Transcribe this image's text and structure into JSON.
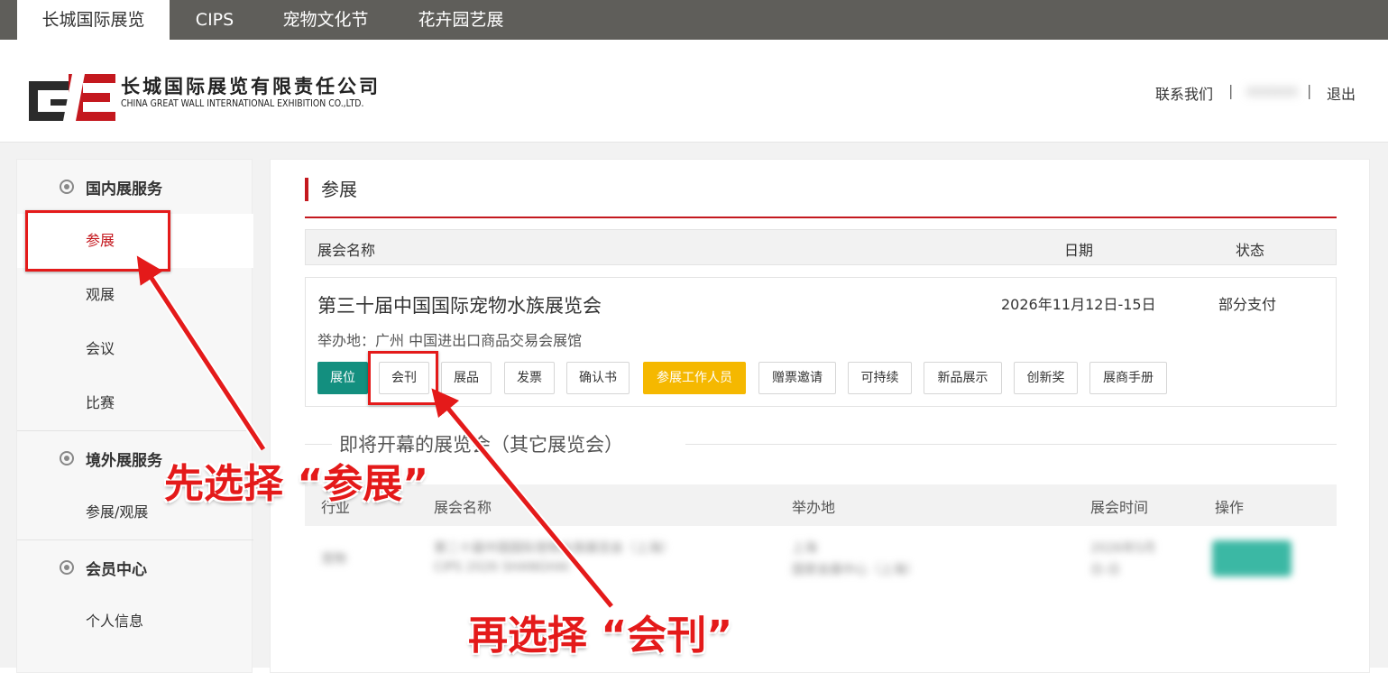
{
  "topnav": {
    "tabs": [
      {
        "label": "长城国际展览",
        "active": true
      },
      {
        "label": "CIPS",
        "active": false
      },
      {
        "label": "宠物文化节",
        "active": false
      },
      {
        "label": "花卉园艺展",
        "active": false
      }
    ]
  },
  "header": {
    "logo_letters": "GE",
    "logo_cn": "长城国际展览有限责任公司",
    "logo_en": "CHINA GREAT WALL INTERNATIONAL EXHIBITION CO.,LTD.",
    "contact": "联系我们",
    "separator": "|",
    "username": "xxxxxx",
    "logout": "退出"
  },
  "sidebar": {
    "groups": [
      {
        "title": "国内展服务",
        "items": [
          "参展",
          "观展",
          "会议",
          "比赛"
        ]
      },
      {
        "title": "境外展服务",
        "items": [
          "参展/观展"
        ]
      },
      {
        "title": "会员中心",
        "items": [
          "个人信息"
        ]
      }
    ],
    "active_item": "参展"
  },
  "main": {
    "section_title": "参展",
    "table_headers": {
      "name": "展会名称",
      "date": "日期",
      "status": "状态"
    },
    "expo": {
      "name": "第三十届中国国际宠物水族展览会",
      "date": "2026年11月12日-15日",
      "status": "部分支付",
      "venue": "举办地：广州  中国进出口商品交易会展馆",
      "buttons": [
        "展位",
        "会刊",
        "展品",
        "发票",
        "确认书",
        "参展工作人员",
        "赠票邀请",
        "可持续",
        "新品展示",
        "创新奖",
        "展商手册"
      ]
    },
    "upcoming_title": "即将开幕的展览会（其它展览会）",
    "upcoming_headers": {
      "industry": "行业",
      "name": "展会名称",
      "venue": "举办地",
      "time": "展会时间",
      "action": "操作"
    },
    "blurred_row": {
      "industry": "宠物",
      "name_line1": "第二十届中国国际宠物水族展览会（上海）",
      "name_line2": "CIPS 2026 SHANGHAI",
      "venue_line1": "上海",
      "venue_line2": "国家会展中心（上海）",
      "time_line1": "2026年5月",
      "time_line2": "日-日",
      "action": "参展"
    }
  },
  "annotations": {
    "step1": "先选择 “参展”",
    "step2": "再选择 “会刊”",
    "color": "#e41a1a"
  },
  "colors": {
    "accent_red": "#c4181e",
    "green_button": "#138f7f",
    "orange_button": "#f5b800",
    "topnav_bg": "#5f5e5a"
  }
}
